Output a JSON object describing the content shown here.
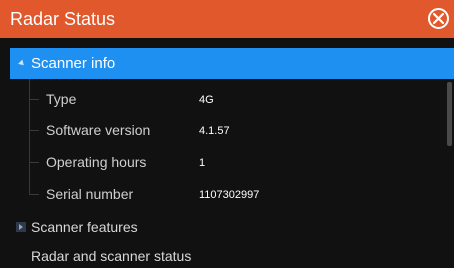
{
  "dialog": {
    "title": "Radar Status"
  },
  "icons": {
    "close": "close-circle-icon",
    "expanded": "triangle-down-icon",
    "collapsed": "triangle-right-icon"
  },
  "colors": {
    "title_bar": "#e0582c",
    "selected_row": "#1e90f2",
    "background": "#111111"
  },
  "tree": {
    "scanner_info": {
      "label": "Scanner info",
      "properties": [
        {
          "label": "Type",
          "value": "4G"
        },
        {
          "label": "Software version",
          "value": "4.1.57"
        },
        {
          "label": "Operating hours",
          "value": "1"
        },
        {
          "label": "Serial number",
          "value": "1107302997"
        }
      ]
    },
    "scanner_features": {
      "label": "Scanner features"
    },
    "next_item": {
      "label": "Radar and scanner status"
    }
  }
}
